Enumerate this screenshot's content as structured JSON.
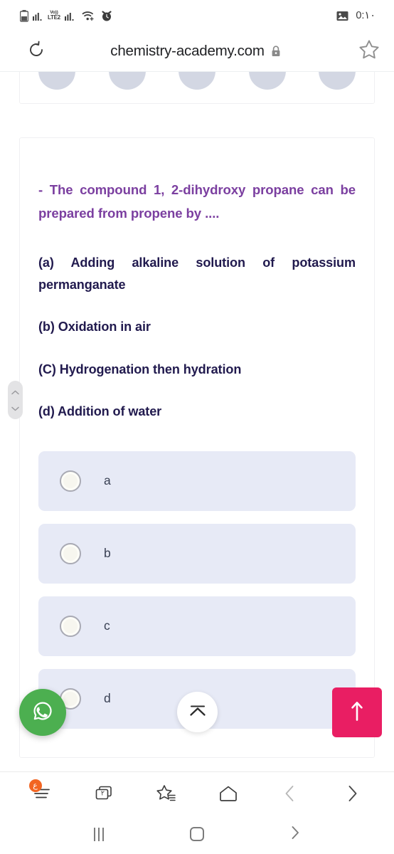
{
  "status_bar": {
    "network_label_top": "Vo))",
    "network_label_bottom": "LTE2",
    "time": "0:Ⴕ",
    "time_display": "0:١٠",
    "icons": [
      "battery-icon",
      "signal-bars-icon",
      "volte-icon",
      "signal-bars-2-icon",
      "wifi-icon",
      "alarm-icon",
      "image-icon"
    ]
  },
  "browser": {
    "url": "chemistry-academy.com",
    "reload_icon": "reload-icon",
    "lock_icon": "lock-icon",
    "bookmark_icon": "star-outline-icon",
    "nav": {
      "menu_badge": "ع",
      "tab_count": "٢",
      "items": [
        {
          "name": "menu-button",
          "icon": "hamburger-menu-icon"
        },
        {
          "name": "tab-switcher-button",
          "icon": "tabs-icon"
        },
        {
          "name": "bookmarks-button",
          "icon": "star-list-icon"
        },
        {
          "name": "home-button",
          "icon": "home-icon"
        },
        {
          "name": "back-button",
          "icon": "chevron-left-icon"
        },
        {
          "name": "forward-button",
          "icon": "chevron-right-icon"
        }
      ]
    }
  },
  "page_content": {
    "avatar_placeholders": 5,
    "question": {
      "stem": "-  The compound 1, 2-dihydroxy propane can be prepared from propene by ....",
      "options": [
        "(a) Adding alkaline solution of potassium permanganate",
        "(b) Oxidation in air",
        "(C) Hydrogenation then hydration",
        "(d) Addition of water"
      ]
    },
    "choices": [
      {
        "label": "a",
        "selected": false
      },
      {
        "label": "b",
        "selected": false
      },
      {
        "label": "c",
        "selected": false
      },
      {
        "label": "d",
        "selected": false
      }
    ]
  },
  "floating_buttons": {
    "whatsapp": {
      "name": "whatsapp-fab",
      "icon": "whatsapp-icon",
      "color": "#4caf50"
    },
    "collapse": {
      "name": "collapse-fab",
      "icon": "chevron-up-bar-icon",
      "color": "#ffffff"
    },
    "scroll_top": {
      "name": "scroll-to-top-button",
      "icon": "arrow-up-icon",
      "color": "#e91e63"
    }
  },
  "scroll_handle": {
    "up_icon": "chevron-up-icon",
    "down_icon": "chevron-down-icon"
  },
  "system_nav": {
    "items": [
      {
        "name": "recents-button",
        "icon": "recents-icon"
      },
      {
        "name": "home-button",
        "icon": "home-square-icon"
      },
      {
        "name": "back-button",
        "icon": "chevron-right-icon"
      }
    ]
  },
  "colors": {
    "question_purple": "#7b3fa0",
    "option_navy": "#211a4e",
    "choice_bg": "#e7eaf6",
    "accent_pink": "#e91e63",
    "whatsapp_green": "#4caf50",
    "badge_orange": "#f26522"
  }
}
